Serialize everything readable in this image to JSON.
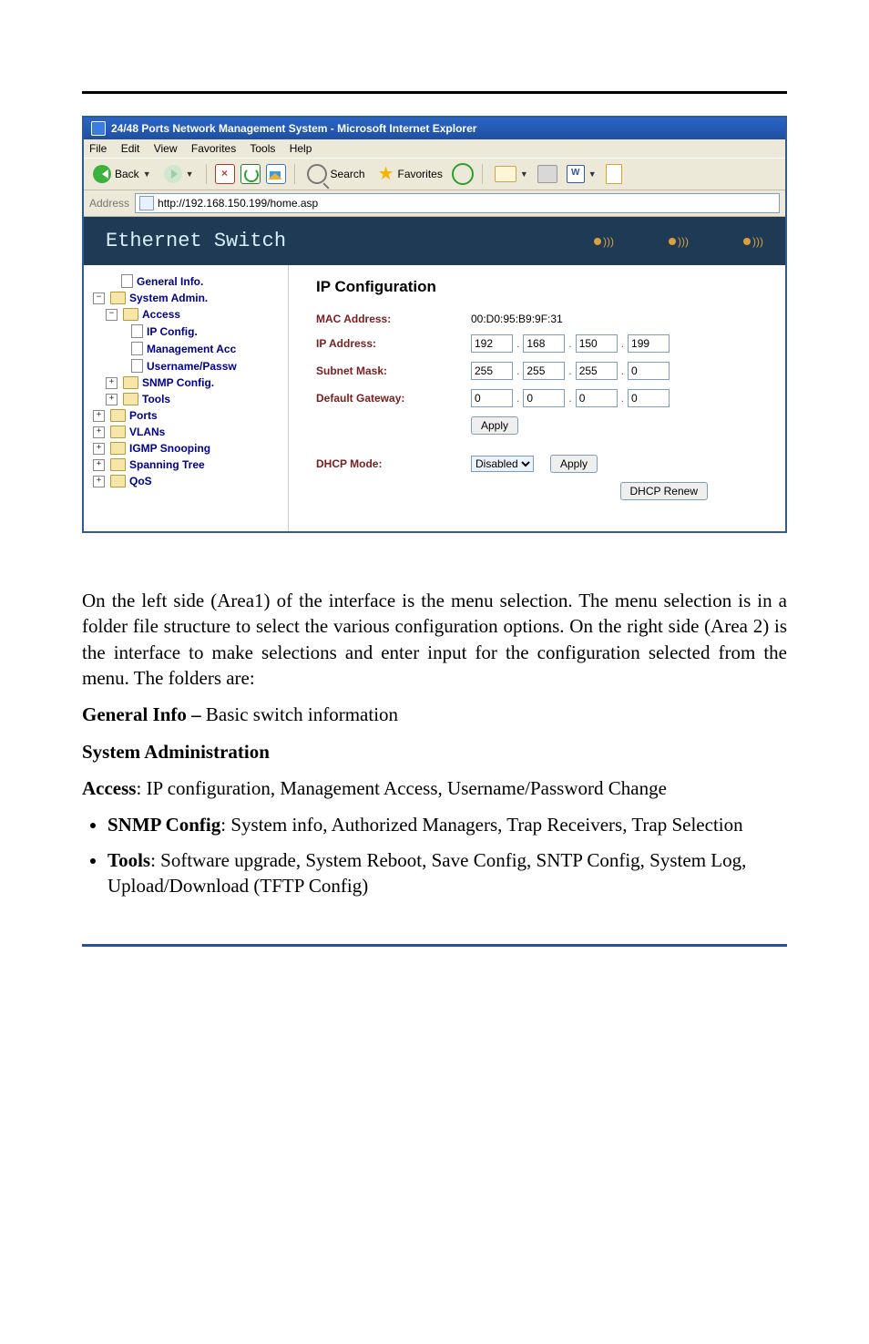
{
  "browser": {
    "title": "24/48 Ports Network Management System - Microsoft Internet Explorer",
    "menus": [
      "File",
      "Edit",
      "View",
      "Favorites",
      "Tools",
      "Help"
    ],
    "back": "Back",
    "search": "Search",
    "favorites": "Favorites",
    "address_label": "Address",
    "url": "http://192.168.150.199/home.asp"
  },
  "banner": {
    "title": "Ethernet Switch"
  },
  "tree": {
    "general": "General Info.",
    "sysadmin": "System Admin.",
    "access": "Access",
    "ipconfig": "IP Config.",
    "mgmtacc": "Management Acc",
    "userpass": "Username/Passw",
    "snmp": "SNMP Config.",
    "tools": "Tools",
    "ports": "Ports",
    "vlans": "VLANs",
    "igmp": "IGMP Snooping",
    "stp": "Spanning Tree",
    "qos": "QoS"
  },
  "main": {
    "heading": "IP Configuration",
    "mac_label": "MAC Address:",
    "mac_value": "00:D0:95:B9:9F:31",
    "ip_label": "IP Address:",
    "ip": [
      "192",
      "168",
      "150",
      "199"
    ],
    "mask_label": "Subnet Mask:",
    "mask": [
      "255",
      "255",
      "255",
      "0"
    ],
    "gw_label": "Default Gateway:",
    "gw": [
      "0",
      "0",
      "0",
      "0"
    ],
    "apply": "Apply",
    "dhcp_label": "DHCP Mode:",
    "dhcp_value": "Disabled",
    "dhcp_apply": "Apply",
    "dhcp_renew": "DHCP Renew"
  },
  "doc": {
    "p1": "On the left side (Area1) of the interface is the menu selection.  The menu selection is in a folder file structure to select the various configuration options.  On the right side (Area 2) is the interface to make selections and enter input for the configuration selected from the menu.  The folders are:",
    "general_b": "General Info –",
    "general_t": " Basic switch information",
    "sysadmin": "System Administration",
    "access_b": "Access",
    "access_t": ": IP configuration, Management Access, Username/Password Change",
    "snmp_b": "SNMP Config",
    "snmp_t": ": System info, Authorized Managers, Trap Receivers, Trap Selection",
    "tools_b": "Tools",
    "tools_t": ": Software upgrade, System Reboot, Save Config, SNTP Config, System Log, Upload/Download (TFTP Config)"
  }
}
